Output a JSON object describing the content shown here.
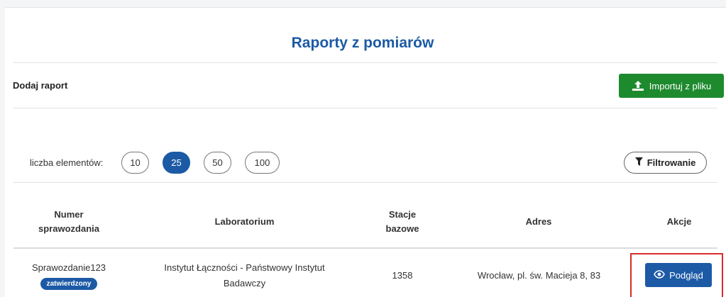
{
  "page": {
    "title": "Raporty z pomiarów",
    "add_report_label": "Dodaj raport",
    "import_button_label": "Importuj z pliku"
  },
  "pagination": {
    "label": "liczba elementów:",
    "options": [
      "10",
      "25",
      "50",
      "100"
    ],
    "selected": "25"
  },
  "filter": {
    "label": "Filtrowanie"
  },
  "table": {
    "headers": {
      "report_number_line1": "Numer",
      "report_number_line2": "sprawozdania",
      "laboratory": "Laboratorium",
      "base_stations_line1": "Stacje",
      "base_stations_line2": "bazowe",
      "address": "Adres",
      "actions": "Akcje"
    },
    "rows": [
      {
        "report_number": "Sprawozdanie123",
        "status": "zatwierdzony",
        "laboratory_line1": "Instytut Łączności - Państwowy Instytut",
        "laboratory_line2": "Badawczy",
        "base_stations": "1358",
        "address": "Wrocław, pl. św. Macieja 8, 83",
        "action_label": "Podgląd"
      }
    ]
  },
  "colors": {
    "primary": "#1c5aa6",
    "success": "#1e8a2e",
    "highlight": "#d92b2b"
  }
}
